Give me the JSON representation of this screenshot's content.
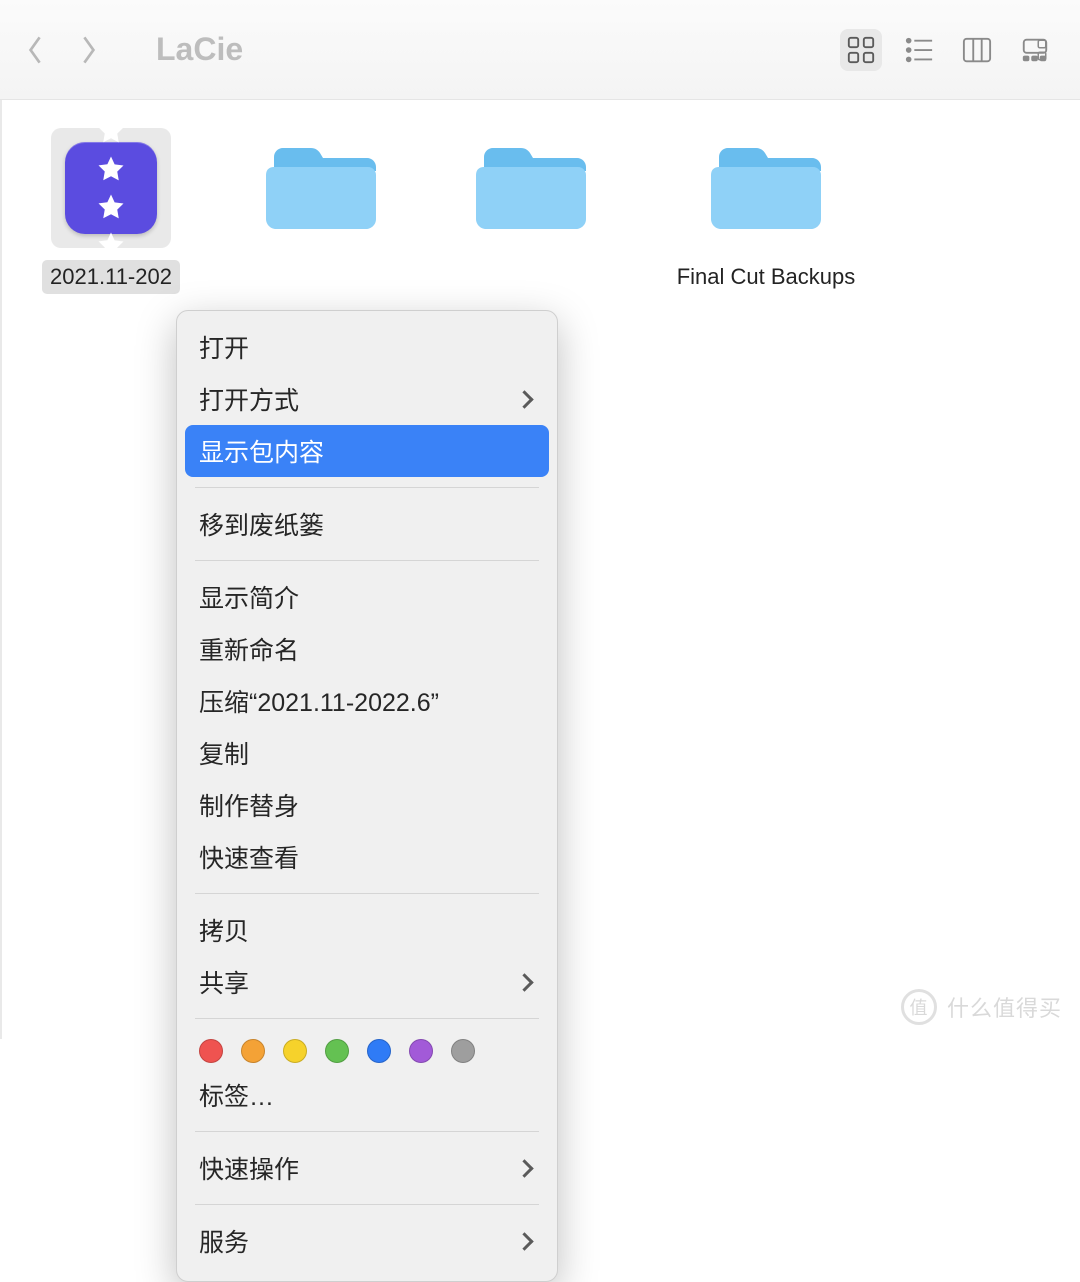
{
  "toolbar": {
    "location": "LaCie"
  },
  "files": [
    {
      "label": "2021.11-202",
      "type": "app",
      "selected": true
    },
    {
      "label": "",
      "type": "folder"
    },
    {
      "label": "",
      "type": "folder"
    },
    {
      "label": "Final Cut Backups",
      "type": "folder"
    }
  ],
  "menu": {
    "open": "打开",
    "open_with": "打开方式",
    "show_package_contents": "显示包内容",
    "move_to_trash": "移到废纸篓",
    "get_info": "显示简介",
    "rename": "重新命名",
    "compress": "压缩“2021.11-2022.6”",
    "duplicate": "复制",
    "make_alias": "制作替身",
    "quick_look": "快速查看",
    "copy": "拷贝",
    "share": "共享",
    "tags": "标签…",
    "quick_actions": "快速操作",
    "services": "服务"
  },
  "tag_colors": [
    "#ef5350",
    "#f4a236",
    "#f6d22b",
    "#64c152",
    "#2f7bf6",
    "#a25ad8",
    "#9e9e9e"
  ],
  "watermark": {
    "badge": "值",
    "text": "什么值得买"
  }
}
